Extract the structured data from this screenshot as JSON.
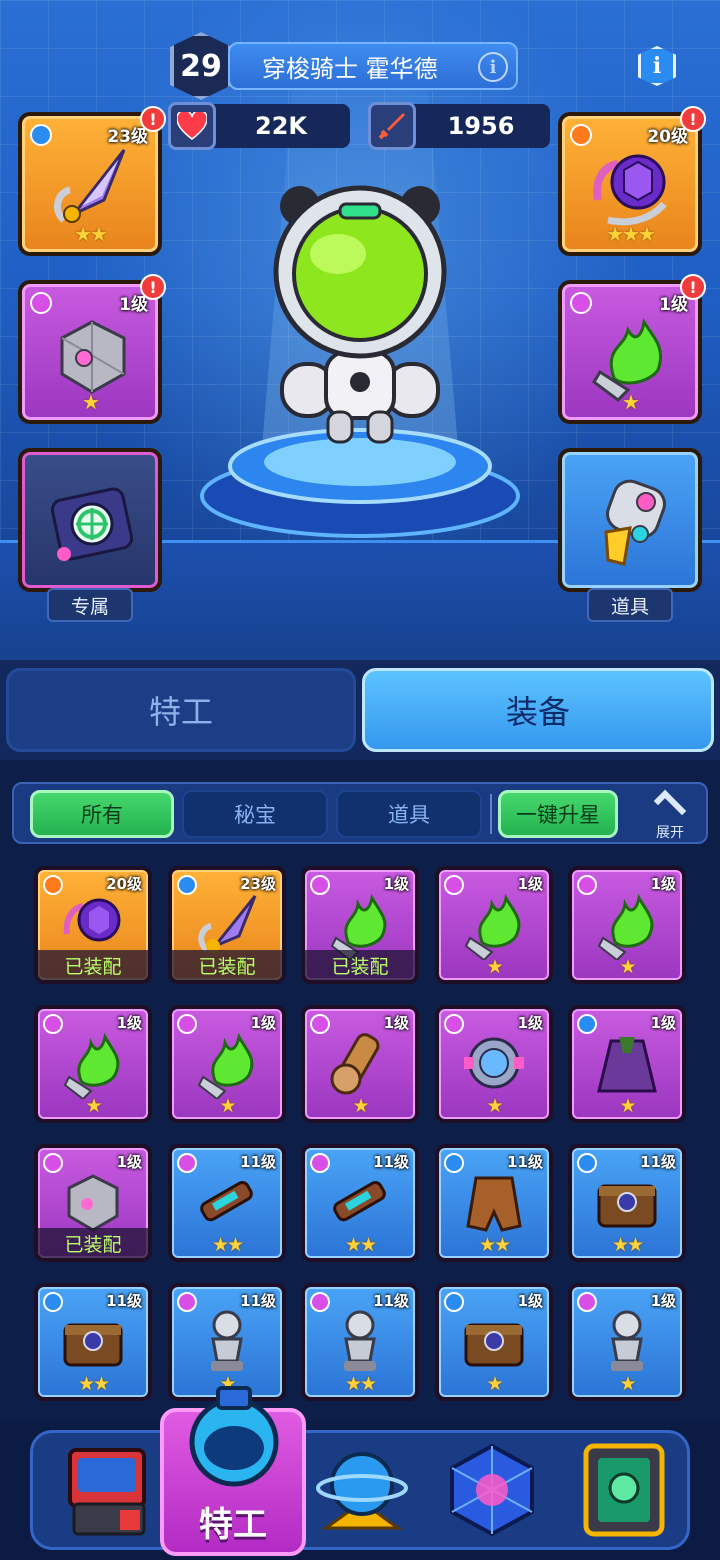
{
  "header": {
    "agent_level": "29",
    "agent_name": "穿梭骑士 霍华德",
    "info_icon": "info-icon"
  },
  "stats": {
    "health": "22K",
    "attack": "1956"
  },
  "equip_slots": {
    "left": [
      {
        "level": "23级",
        "rarity": "gold",
        "stars": "★★",
        "alert": "!",
        "icon": "crystal-spear-icon"
      },
      {
        "level": "1级",
        "rarity": "purple",
        "stars": "★",
        "alert": "!",
        "icon": "tech-cube-icon"
      },
      {
        "level": "",
        "rarity": "dark",
        "stars": "",
        "alert": "",
        "icon": "target-device-icon",
        "label": "专属"
      }
    ],
    "right": [
      {
        "level": "20级",
        "rarity": "gold",
        "stars": "★★★",
        "alert": "!",
        "icon": "crystal-orb-icon"
      },
      {
        "level": "1级",
        "rarity": "purple",
        "stars": "★",
        "alert": "!",
        "icon": "green-flame-blade-icon"
      },
      {
        "level": "",
        "rarity": "blue",
        "stars": "",
        "alert": "",
        "icon": "rocket-jar-icon",
        "label": "道具"
      }
    ]
  },
  "tabs": {
    "agent": "特工",
    "equipment": "装备"
  },
  "filters": {
    "all": "所有",
    "treasure": "秘宝",
    "items": "道具",
    "upgrade_all": "一键升星",
    "expand": "展开"
  },
  "equipped_text": "已装配",
  "inventory": [
    {
      "level": "20级",
      "rarity": "gold",
      "stars": "",
      "equipped": true,
      "icon": "crystal-orb-icon",
      "badge": "#ff7a1a"
    },
    {
      "level": "23级",
      "rarity": "gold",
      "stars": "",
      "equipped": true,
      "icon": "crystal-spear-icon",
      "badge": "#2a8cf0"
    },
    {
      "level": "1级",
      "rarity": "purple",
      "stars": "",
      "equipped": true,
      "icon": "green-flame-blade-icon",
      "badge": "#d84fe8"
    },
    {
      "level": "1级",
      "rarity": "purple",
      "stars": "★",
      "equipped": false,
      "icon": "green-flame-blade-icon",
      "badge": "#d84fe8"
    },
    {
      "level": "1级",
      "rarity": "purple",
      "stars": "★",
      "equipped": false,
      "icon": "green-flame-blade-icon",
      "badge": "#d84fe8"
    },
    {
      "level": "1级",
      "rarity": "purple",
      "stars": "★",
      "equipped": false,
      "icon": "green-flame-blade-icon",
      "badge": "#d84fe8"
    },
    {
      "level": "1级",
      "rarity": "purple",
      "stars": "★",
      "equipped": false,
      "icon": "green-flame-blade-icon",
      "badge": "#d84fe8"
    },
    {
      "level": "1级",
      "rarity": "purple",
      "stars": "★",
      "equipped": false,
      "icon": "scroll-gauntlet-icon",
      "badge": "#d84fe8"
    },
    {
      "level": "1级",
      "rarity": "purple",
      "stars": "★",
      "equipped": false,
      "icon": "energy-core-icon",
      "badge": "#d84fe8"
    },
    {
      "level": "1级",
      "rarity": "purple",
      "stars": "★",
      "equipped": false,
      "icon": "dark-cloak-icon",
      "badge": "#2a8cf0"
    },
    {
      "level": "1级",
      "rarity": "purple",
      "stars": "",
      "equipped": true,
      "icon": "tech-cube-icon",
      "badge": "#d84fe8"
    },
    {
      "level": "11级",
      "rarity": "blue",
      "stars": "★★",
      "equipped": false,
      "icon": "laser-gun-icon",
      "badge": "#d84fe8"
    },
    {
      "level": "11级",
      "rarity": "blue",
      "stars": "★★",
      "equipped": false,
      "icon": "laser-gun-icon",
      "badge": "#d84fe8"
    },
    {
      "level": "11级",
      "rarity": "blue",
      "stars": "★★",
      "equipped": false,
      "icon": "leather-cape-icon",
      "badge": "#2a8cf0"
    },
    {
      "level": "11级",
      "rarity": "blue",
      "stars": "★★",
      "equipped": false,
      "icon": "treasure-chest-icon",
      "badge": "#2a8cf0"
    },
    {
      "level": "11级",
      "rarity": "blue",
      "stars": "★★",
      "equipped": false,
      "icon": "treasure-chest-icon",
      "badge": "#2a8cf0"
    },
    {
      "level": "11级",
      "rarity": "blue",
      "stars": "★",
      "equipped": false,
      "icon": "silver-statue-icon",
      "badge": "#d84fe8"
    },
    {
      "level": "11级",
      "rarity": "blue",
      "stars": "★★",
      "equipped": false,
      "icon": "silver-statue-icon",
      "badge": "#d84fe8"
    },
    {
      "level": "1级",
      "rarity": "blue",
      "stars": "★",
      "equipped": false,
      "icon": "treasure-chest-icon",
      "badge": "#2a8cf0"
    },
    {
      "level": "1级",
      "rarity": "blue",
      "stars": "★",
      "equipped": false,
      "icon": "silver-statue-icon",
      "badge": "#d84fe8"
    }
  ],
  "bottom_nav": {
    "active_label": "特工",
    "items": [
      "shop-machine-icon",
      "agent-helmet-icon",
      "planet-icon",
      "crystal-cube-icon",
      "card-frame-icon"
    ]
  }
}
